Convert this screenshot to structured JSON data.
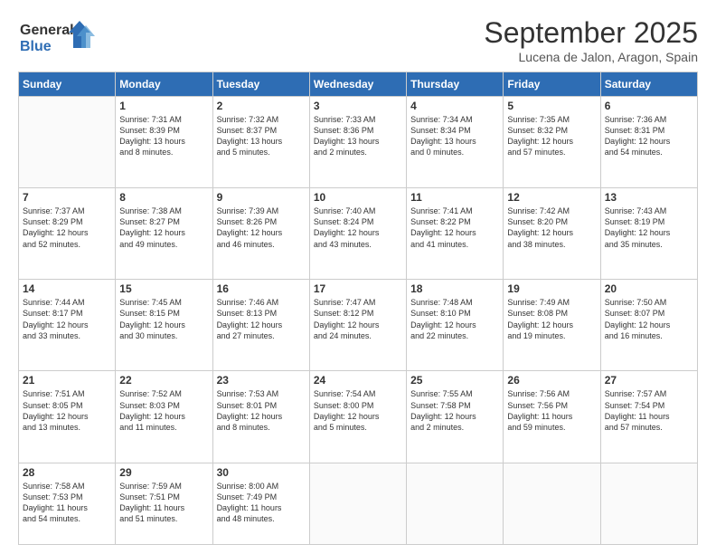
{
  "header": {
    "logo_line1": "General",
    "logo_line2": "Blue",
    "month": "September 2025",
    "location": "Lucena de Jalon, Aragon, Spain"
  },
  "weekdays": [
    "Sunday",
    "Monday",
    "Tuesday",
    "Wednesday",
    "Thursday",
    "Friday",
    "Saturday"
  ],
  "weeks": [
    [
      {
        "day": "",
        "content": ""
      },
      {
        "day": "1",
        "content": "Sunrise: 7:31 AM\nSunset: 8:39 PM\nDaylight: 13 hours\nand 8 minutes."
      },
      {
        "day": "2",
        "content": "Sunrise: 7:32 AM\nSunset: 8:37 PM\nDaylight: 13 hours\nand 5 minutes."
      },
      {
        "day": "3",
        "content": "Sunrise: 7:33 AM\nSunset: 8:36 PM\nDaylight: 13 hours\nand 2 minutes."
      },
      {
        "day": "4",
        "content": "Sunrise: 7:34 AM\nSunset: 8:34 PM\nDaylight: 13 hours\nand 0 minutes."
      },
      {
        "day": "5",
        "content": "Sunrise: 7:35 AM\nSunset: 8:32 PM\nDaylight: 12 hours\nand 57 minutes."
      },
      {
        "day": "6",
        "content": "Sunrise: 7:36 AM\nSunset: 8:31 PM\nDaylight: 12 hours\nand 54 minutes."
      }
    ],
    [
      {
        "day": "7",
        "content": "Sunrise: 7:37 AM\nSunset: 8:29 PM\nDaylight: 12 hours\nand 52 minutes."
      },
      {
        "day": "8",
        "content": "Sunrise: 7:38 AM\nSunset: 8:27 PM\nDaylight: 12 hours\nand 49 minutes."
      },
      {
        "day": "9",
        "content": "Sunrise: 7:39 AM\nSunset: 8:26 PM\nDaylight: 12 hours\nand 46 minutes."
      },
      {
        "day": "10",
        "content": "Sunrise: 7:40 AM\nSunset: 8:24 PM\nDaylight: 12 hours\nand 43 minutes."
      },
      {
        "day": "11",
        "content": "Sunrise: 7:41 AM\nSunset: 8:22 PM\nDaylight: 12 hours\nand 41 minutes."
      },
      {
        "day": "12",
        "content": "Sunrise: 7:42 AM\nSunset: 8:20 PM\nDaylight: 12 hours\nand 38 minutes."
      },
      {
        "day": "13",
        "content": "Sunrise: 7:43 AM\nSunset: 8:19 PM\nDaylight: 12 hours\nand 35 minutes."
      }
    ],
    [
      {
        "day": "14",
        "content": "Sunrise: 7:44 AM\nSunset: 8:17 PM\nDaylight: 12 hours\nand 33 minutes."
      },
      {
        "day": "15",
        "content": "Sunrise: 7:45 AM\nSunset: 8:15 PM\nDaylight: 12 hours\nand 30 minutes."
      },
      {
        "day": "16",
        "content": "Sunrise: 7:46 AM\nSunset: 8:13 PM\nDaylight: 12 hours\nand 27 minutes."
      },
      {
        "day": "17",
        "content": "Sunrise: 7:47 AM\nSunset: 8:12 PM\nDaylight: 12 hours\nand 24 minutes."
      },
      {
        "day": "18",
        "content": "Sunrise: 7:48 AM\nSunset: 8:10 PM\nDaylight: 12 hours\nand 22 minutes."
      },
      {
        "day": "19",
        "content": "Sunrise: 7:49 AM\nSunset: 8:08 PM\nDaylight: 12 hours\nand 19 minutes."
      },
      {
        "day": "20",
        "content": "Sunrise: 7:50 AM\nSunset: 8:07 PM\nDaylight: 12 hours\nand 16 minutes."
      }
    ],
    [
      {
        "day": "21",
        "content": "Sunrise: 7:51 AM\nSunset: 8:05 PM\nDaylight: 12 hours\nand 13 minutes."
      },
      {
        "day": "22",
        "content": "Sunrise: 7:52 AM\nSunset: 8:03 PM\nDaylight: 12 hours\nand 11 minutes."
      },
      {
        "day": "23",
        "content": "Sunrise: 7:53 AM\nSunset: 8:01 PM\nDaylight: 12 hours\nand 8 minutes."
      },
      {
        "day": "24",
        "content": "Sunrise: 7:54 AM\nSunset: 8:00 PM\nDaylight: 12 hours\nand 5 minutes."
      },
      {
        "day": "25",
        "content": "Sunrise: 7:55 AM\nSunset: 7:58 PM\nDaylight: 12 hours\nand 2 minutes."
      },
      {
        "day": "26",
        "content": "Sunrise: 7:56 AM\nSunset: 7:56 PM\nDaylight: 11 hours\nand 59 minutes."
      },
      {
        "day": "27",
        "content": "Sunrise: 7:57 AM\nSunset: 7:54 PM\nDaylight: 11 hours\nand 57 minutes."
      }
    ],
    [
      {
        "day": "28",
        "content": "Sunrise: 7:58 AM\nSunset: 7:53 PM\nDaylight: 11 hours\nand 54 minutes."
      },
      {
        "day": "29",
        "content": "Sunrise: 7:59 AM\nSunset: 7:51 PM\nDaylight: 11 hours\nand 51 minutes."
      },
      {
        "day": "30",
        "content": "Sunrise: 8:00 AM\nSunset: 7:49 PM\nDaylight: 11 hours\nand 48 minutes."
      },
      {
        "day": "",
        "content": ""
      },
      {
        "day": "",
        "content": ""
      },
      {
        "day": "",
        "content": ""
      },
      {
        "day": "",
        "content": ""
      }
    ]
  ]
}
